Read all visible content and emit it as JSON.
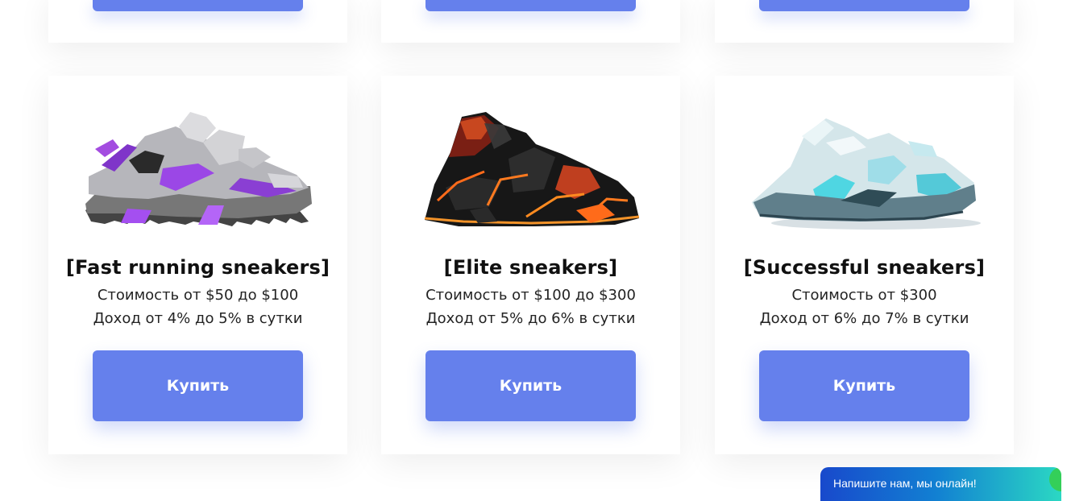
{
  "products": [
    {
      "title": "[Fast running sneakers]",
      "cost": "Стоимость от $50 до $100",
      "income": "Доход от 4% до 5% в сутки",
      "button_label": "Купить",
      "image_icon": "sneaker-purple-gray-icon"
    },
    {
      "title": "[Elite sneakers]",
      "cost": "Стоимость от $100 до $300",
      "income": "Доход от 5% до 6% в сутки",
      "button_label": "Купить",
      "image_icon": "sneaker-black-orange-icon"
    },
    {
      "title": "[Successful sneakers]",
      "cost": "Стоимость от $300",
      "income": "Доход от 6% до 7% в сутки",
      "button_label": "Купить",
      "image_icon": "sneaker-white-cyan-icon"
    }
  ],
  "chat": {
    "label": "Напишите нам, мы онлайн!"
  },
  "colors": {
    "accent": "#6580ec",
    "chat_gradient_start": "#1849cc",
    "chat_gradient_end": "#2bd8c3",
    "chat_status": "#34cf59"
  }
}
